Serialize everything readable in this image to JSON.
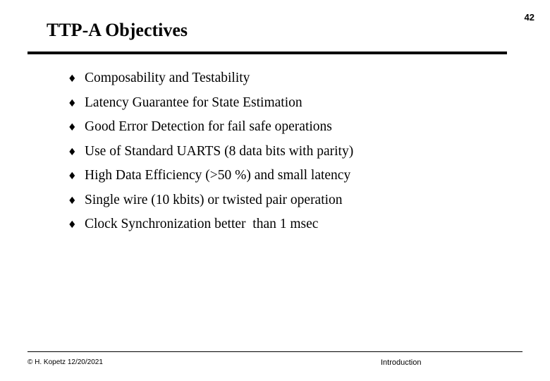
{
  "slide": {
    "page_number": "42",
    "title": "TTP-A Objectives",
    "bullet_mark": "♦",
    "bullets": [
      {
        "text": "Composability and Testability"
      },
      {
        "text": "Latency Guarantee for State Estimation"
      },
      {
        "text": "Good Error Detection for fail safe operations"
      },
      {
        "text": "Use of Standard UARTS (8 data bits with parity)"
      },
      {
        "text": "High Data Efficiency (>50 %) and small latency"
      },
      {
        "text": "Single wire (10 kbits) or twisted pair operation"
      },
      {
        "text": "Clock Synchronization better  than 1 msec"
      }
    ],
    "footer": {
      "left": "© H. Kopetz  12/20/2021",
      "center": "Introduction"
    }
  }
}
